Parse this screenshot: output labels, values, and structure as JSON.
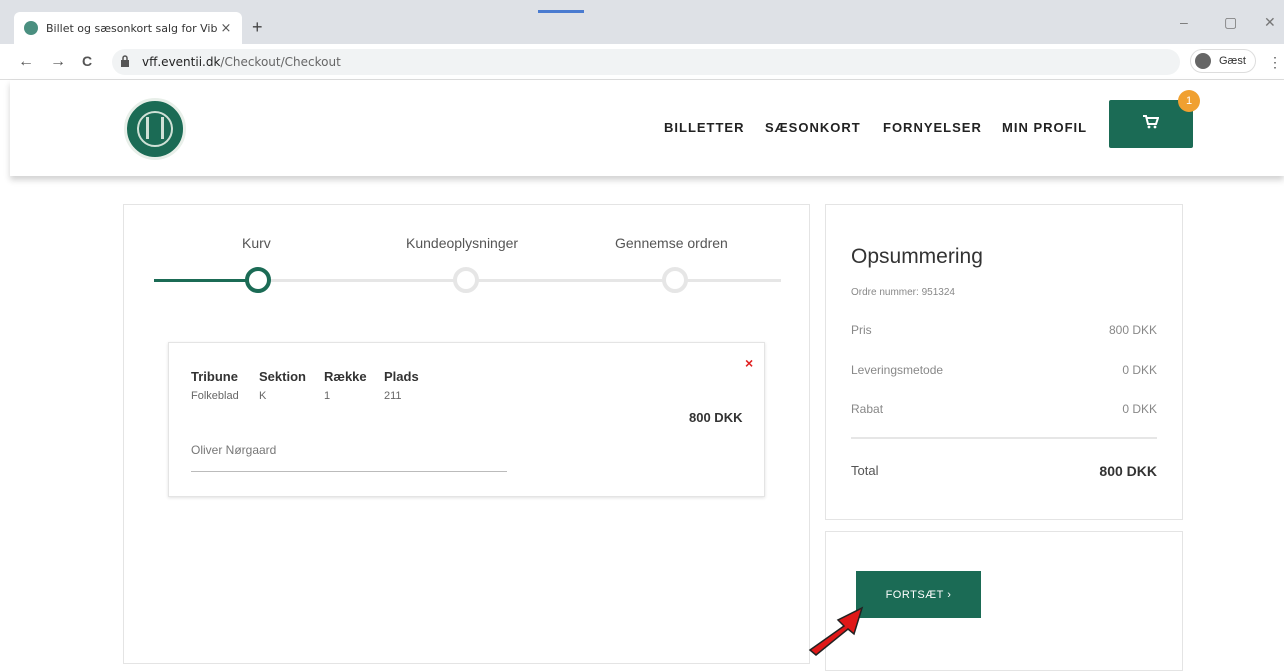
{
  "browser": {
    "tab_title": "Billet og sæsonkort salg for Vibor",
    "tab_close": "×",
    "new_tab": "+",
    "url_domain": "vff.eventii.dk",
    "url_path": "/Checkout/Checkout",
    "profile_label": "Gæst",
    "back": "←",
    "forward": "→",
    "reload": "C",
    "minimize": "–",
    "restore": "▢",
    "close": "✕",
    "menu": "⋮"
  },
  "header": {
    "nav": [
      "BILLETTER",
      "SÆSONKORT",
      "FORNYELSER",
      "MIN PROFIL"
    ],
    "cart_count": "1",
    "cart_icon": "cart-icon"
  },
  "steps": {
    "items": [
      "Kurv",
      "Kundeoplysninger",
      "Gennemse ordren"
    ],
    "active_index": 0
  },
  "cart_item": {
    "headers": [
      "Tribune",
      "Sektion",
      "Række",
      "Plads"
    ],
    "values": [
      "Folkeblad",
      "K",
      "1",
      "211"
    ],
    "price": "800 DKK",
    "holder": "Oliver Nørgaard",
    "remove": "×"
  },
  "summary": {
    "title": "Opsummering",
    "order_number": "Ordre nummer: 951324",
    "rows": [
      {
        "label": "Pris",
        "value": "800 DKK"
      },
      {
        "label": "Leveringsmetode",
        "value": "0 DKK"
      },
      {
        "label": "Rabat",
        "value": "0 DKK"
      }
    ],
    "total_label": "Total",
    "total_value": "800 DKK"
  },
  "actions": {
    "continue_label": "FORTSÆT ›"
  },
  "colors": {
    "brand": "#1b6b55",
    "badge": "#f0a030",
    "remove": "#e02020",
    "arrow": "#e01818"
  }
}
